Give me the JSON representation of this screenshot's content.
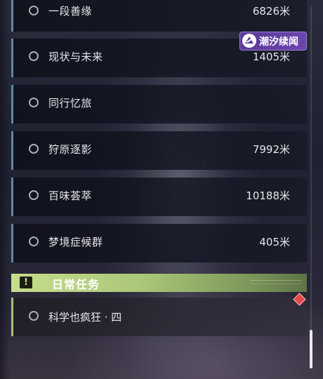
{
  "brand": {
    "label": "潮汐续闻",
    "accent": "#6b45ad"
  },
  "quests": [
    {
      "name": "一段善缘",
      "distance": "6826米",
      "icon": "radio-unchecked-icon"
    },
    {
      "name": "现状与未来",
      "distance": "1405米",
      "icon": "radio-unchecked-icon"
    },
    {
      "name": "同行忆旅",
      "distance": "",
      "icon": "radio-unchecked-icon"
    },
    {
      "name": "狩原逐影",
      "distance": "7992米",
      "icon": "radio-unchecked-icon"
    },
    {
      "name": "百味荟萃",
      "distance": "10188米",
      "icon": "radio-unchecked-icon"
    },
    {
      "name": "梦境症候群",
      "distance": "405米",
      "icon": "radio-unchecked-icon"
    }
  ],
  "daily": {
    "title": "日常任务",
    "icon_glyph": "!",
    "accent": "#c6de8c",
    "quests": [
      {
        "name": "科学也疯狂 · 四",
        "icon": "radio-unchecked-icon",
        "marker": "red-diamond-icon"
      }
    ]
  }
}
